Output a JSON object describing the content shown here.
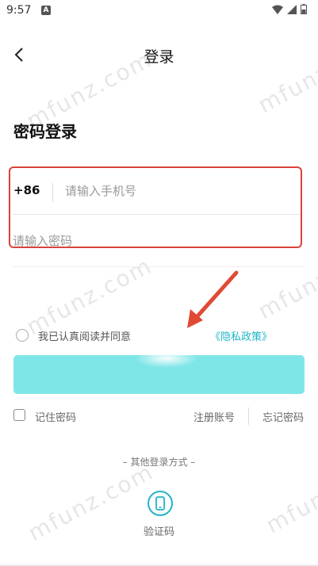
{
  "status_bar": {
    "time": "9:57",
    "badge": "A"
  },
  "header": {
    "title": "登录"
  },
  "section_title": "密码登录",
  "form": {
    "country_code": "+86",
    "phone_placeholder": "请输入手机号",
    "password_placeholder": "请输入密码"
  },
  "agreement": {
    "text": "我已认真阅读并同意",
    "policy_link": "《隐私政策》"
  },
  "login_button": {
    "label": ""
  },
  "options": {
    "remember": "记住密码",
    "register": "注册账号",
    "forgot": "忘记密码"
  },
  "other_methods": {
    "title": "– 其他登录方式 –",
    "sms_label": "验证码"
  },
  "watermark": "mfunz.com",
  "colors": {
    "accent": "#1fb5c7",
    "button": "#7fe6e8",
    "highlight": "#d9433a"
  }
}
